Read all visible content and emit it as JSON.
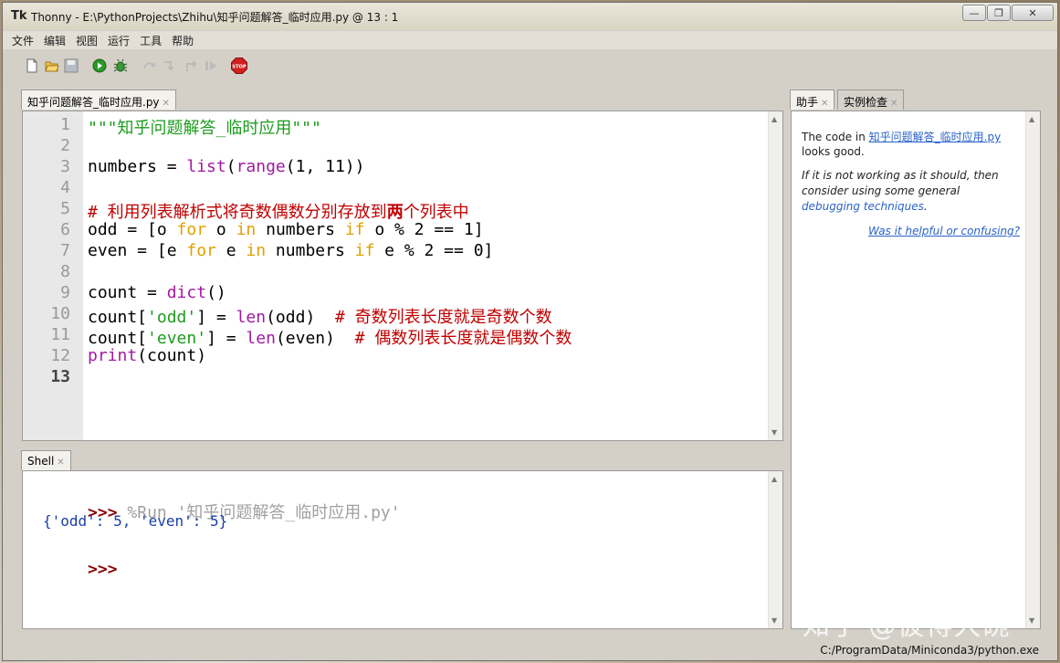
{
  "window": {
    "title": "Thonny  -  E:\\PythonProjects\\Zhihu\\知乎问题解答_临时应用.py  @  13 : 1",
    "app_icon": "Tk"
  },
  "menu": [
    "文件",
    "编辑",
    "视图",
    "运行",
    "工具",
    "帮助"
  ],
  "toolbar": {
    "icons": [
      "new-file-icon",
      "open-file-icon",
      "save-icon",
      "run-icon",
      "debug-icon",
      "step-over-icon",
      "step-into-icon",
      "step-out-icon",
      "resume-icon",
      "stop-icon"
    ],
    "stop_label": "STOP"
  },
  "editor": {
    "tab_label": "知乎问题解答_临时应用.py",
    "line_numbers": [
      "1",
      "2",
      "3",
      "4",
      "5",
      "6",
      "7",
      "8",
      "9",
      "10",
      "11",
      "12",
      "13"
    ],
    "lines": [
      [
        {
          "t": "\"\"\"知乎问题解答_临时应用\"\"\"",
          "c": "s"
        }
      ],
      [],
      [
        {
          "t": "numbers = ",
          "c": ""
        },
        {
          "t": "list",
          "c": "b"
        },
        {
          "t": "(",
          "c": ""
        },
        {
          "t": "range",
          "c": "b"
        },
        {
          "t": "(1, 11))",
          "c": ""
        }
      ],
      [],
      [
        {
          "t": "# 利用列表解析式将奇数偶数分别存放到",
          "c": "c"
        },
        {
          "t": "两",
          "c": "cb"
        },
        {
          "t": "个列表中",
          "c": "c"
        }
      ],
      [
        {
          "t": "odd = [o ",
          "c": ""
        },
        {
          "t": "for",
          "c": "k"
        },
        {
          "t": " o ",
          "c": ""
        },
        {
          "t": "in",
          "c": "k"
        },
        {
          "t": " numbers ",
          "c": ""
        },
        {
          "t": "if",
          "c": "k"
        },
        {
          "t": " o % 2 == 1]",
          "c": ""
        }
      ],
      [
        {
          "t": "even = [e ",
          "c": ""
        },
        {
          "t": "for",
          "c": "k"
        },
        {
          "t": " e ",
          "c": ""
        },
        {
          "t": "in",
          "c": "k"
        },
        {
          "t": " numbers ",
          "c": ""
        },
        {
          "t": "if",
          "c": "k"
        },
        {
          "t": " e % 2 == 0]",
          "c": ""
        }
      ],
      [],
      [
        {
          "t": "count = ",
          "c": ""
        },
        {
          "t": "dict",
          "c": "b"
        },
        {
          "t": "()",
          "c": ""
        }
      ],
      [
        {
          "t": "count[",
          "c": ""
        },
        {
          "t": "'odd'",
          "c": "s"
        },
        {
          "t": "] = ",
          "c": ""
        },
        {
          "t": "len",
          "c": "b"
        },
        {
          "t": "(odd)  ",
          "c": ""
        },
        {
          "t": "# 奇数列表长度就是奇数个数",
          "c": "c"
        }
      ],
      [
        {
          "t": "count[",
          "c": ""
        },
        {
          "t": "'even'",
          "c": "s"
        },
        {
          "t": "] = ",
          "c": ""
        },
        {
          "t": "len",
          "c": "b"
        },
        {
          "t": "(even)  ",
          "c": ""
        },
        {
          "t": "# 偶数列表长度就是偶数个数",
          "c": "c"
        }
      ],
      [
        {
          "t": "print",
          "c": "b"
        },
        {
          "t": "(count)",
          "c": ""
        }
      ],
      []
    ]
  },
  "shell": {
    "tab_label": "Shell",
    "prompt": ">>>",
    "run_command": "%Run '知乎问题解答_临时应用.py'",
    "output": "{'odd': 5, 'even': 5}"
  },
  "assistant": {
    "tabs": [
      "助手",
      "实例检查"
    ],
    "code_in": "The code in ",
    "file_link": "知乎问题解答_临时应用.py",
    "looks_good": "looks good.",
    "hint_line1": "If it is not working as it should, then",
    "hint_line2": "consider using some general",
    "debug_link": "debugging techniques",
    "period": ".",
    "feedback_link": "Was it helpful or confusing?"
  },
  "watermark": "知乎 @彼得大碗",
  "status": {
    "interpreter": "C:/ProgramData/Miniconda3/python.exe"
  }
}
